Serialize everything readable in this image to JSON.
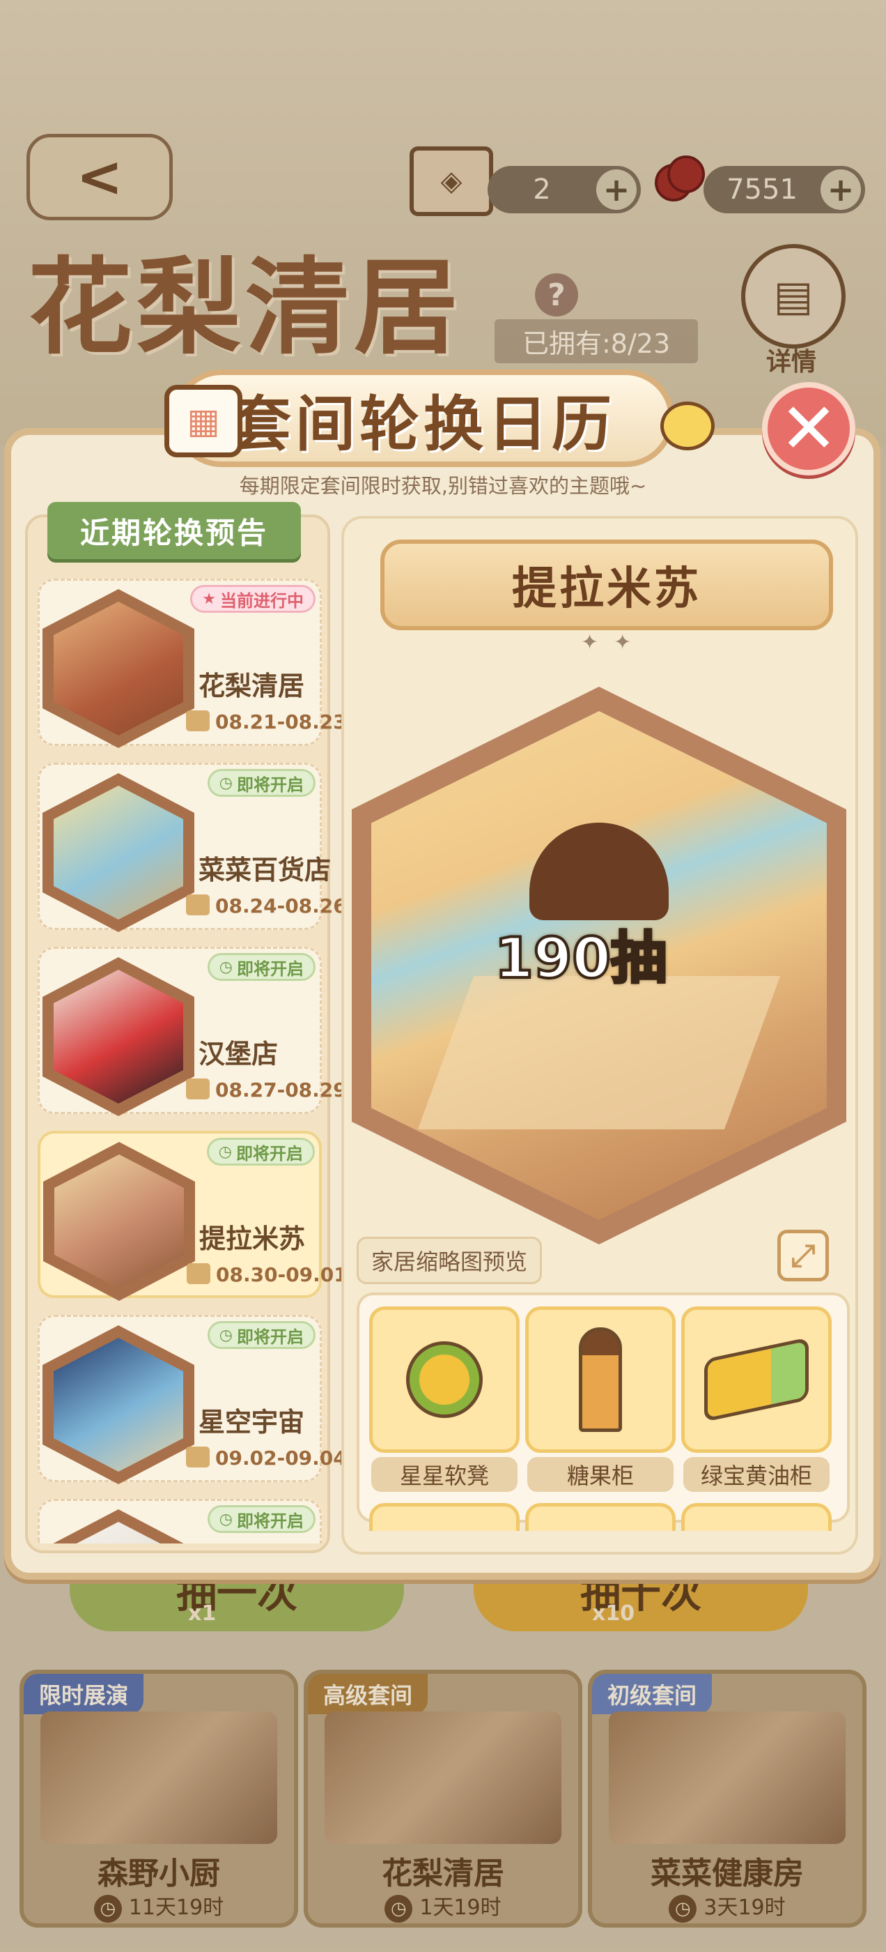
{
  "top_bar": {
    "back_label": "<",
    "tickets": "2",
    "cherries": "7551",
    "plus": "+"
  },
  "suite": {
    "title": "花梨清居",
    "help": "?",
    "owned": "已拥有:8/23",
    "details": "详情"
  },
  "draw_buttons": {
    "once_label": "抽一次",
    "once_mult": "x1",
    "ten_label": "抽十次",
    "ten_mult": "x10"
  },
  "suite_cards": [
    {
      "tag": "限时展演",
      "name": "森野小厨",
      "timer": "11天19时",
      "tag_color": "#5b6fa8"
    },
    {
      "tag": "高级套间",
      "name": "花梨清居",
      "timer": "1天19时",
      "tag_color": "#a87c3c"
    },
    {
      "tag": "初级套间",
      "name": "菜菜健康房",
      "timer": "3天19时",
      "tag_color": "#6a7fb3"
    }
  ],
  "modal": {
    "title": "套间轮换日历",
    "subtitle": "每期限定套间限时获取,别错过喜欢的主题哦~",
    "close": "✕",
    "list_header": "近期轮换预告",
    "items": [
      {
        "name": "花梨清居",
        "date": "08.21-08.23",
        "badge": "当前进行中",
        "status": "live"
      },
      {
        "name": "菜菜百货店",
        "date": "08.24-08.26",
        "badge": "即将开启",
        "status": "soon"
      },
      {
        "name": "汉堡店",
        "date": "08.27-08.29",
        "badge": "即将开启",
        "status": "soon"
      },
      {
        "name": "提拉米苏",
        "date": "08.30-09.01",
        "badge": "即将开启",
        "status": "soon"
      },
      {
        "name": "星空宇宙",
        "date": "09.02-09.04",
        "badge": "即将开启",
        "status": "soon"
      },
      {
        "name": "",
        "date": "",
        "badge": "即将开启",
        "status": "soon"
      }
    ],
    "preview": {
      "title": "提拉米苏",
      "sparkle": "✦✦",
      "draws": "190抽",
      "thumb_label": "家居缩略图预览",
      "expand": "⤢",
      "furniture": [
        "星星软凳",
        "糖果柜",
        "绿宝黄油柜"
      ]
    }
  },
  "colors": {
    "accent_green": "#7da35a",
    "close_red": "#e86f69",
    "live_badge": "#e0606e"
  }
}
